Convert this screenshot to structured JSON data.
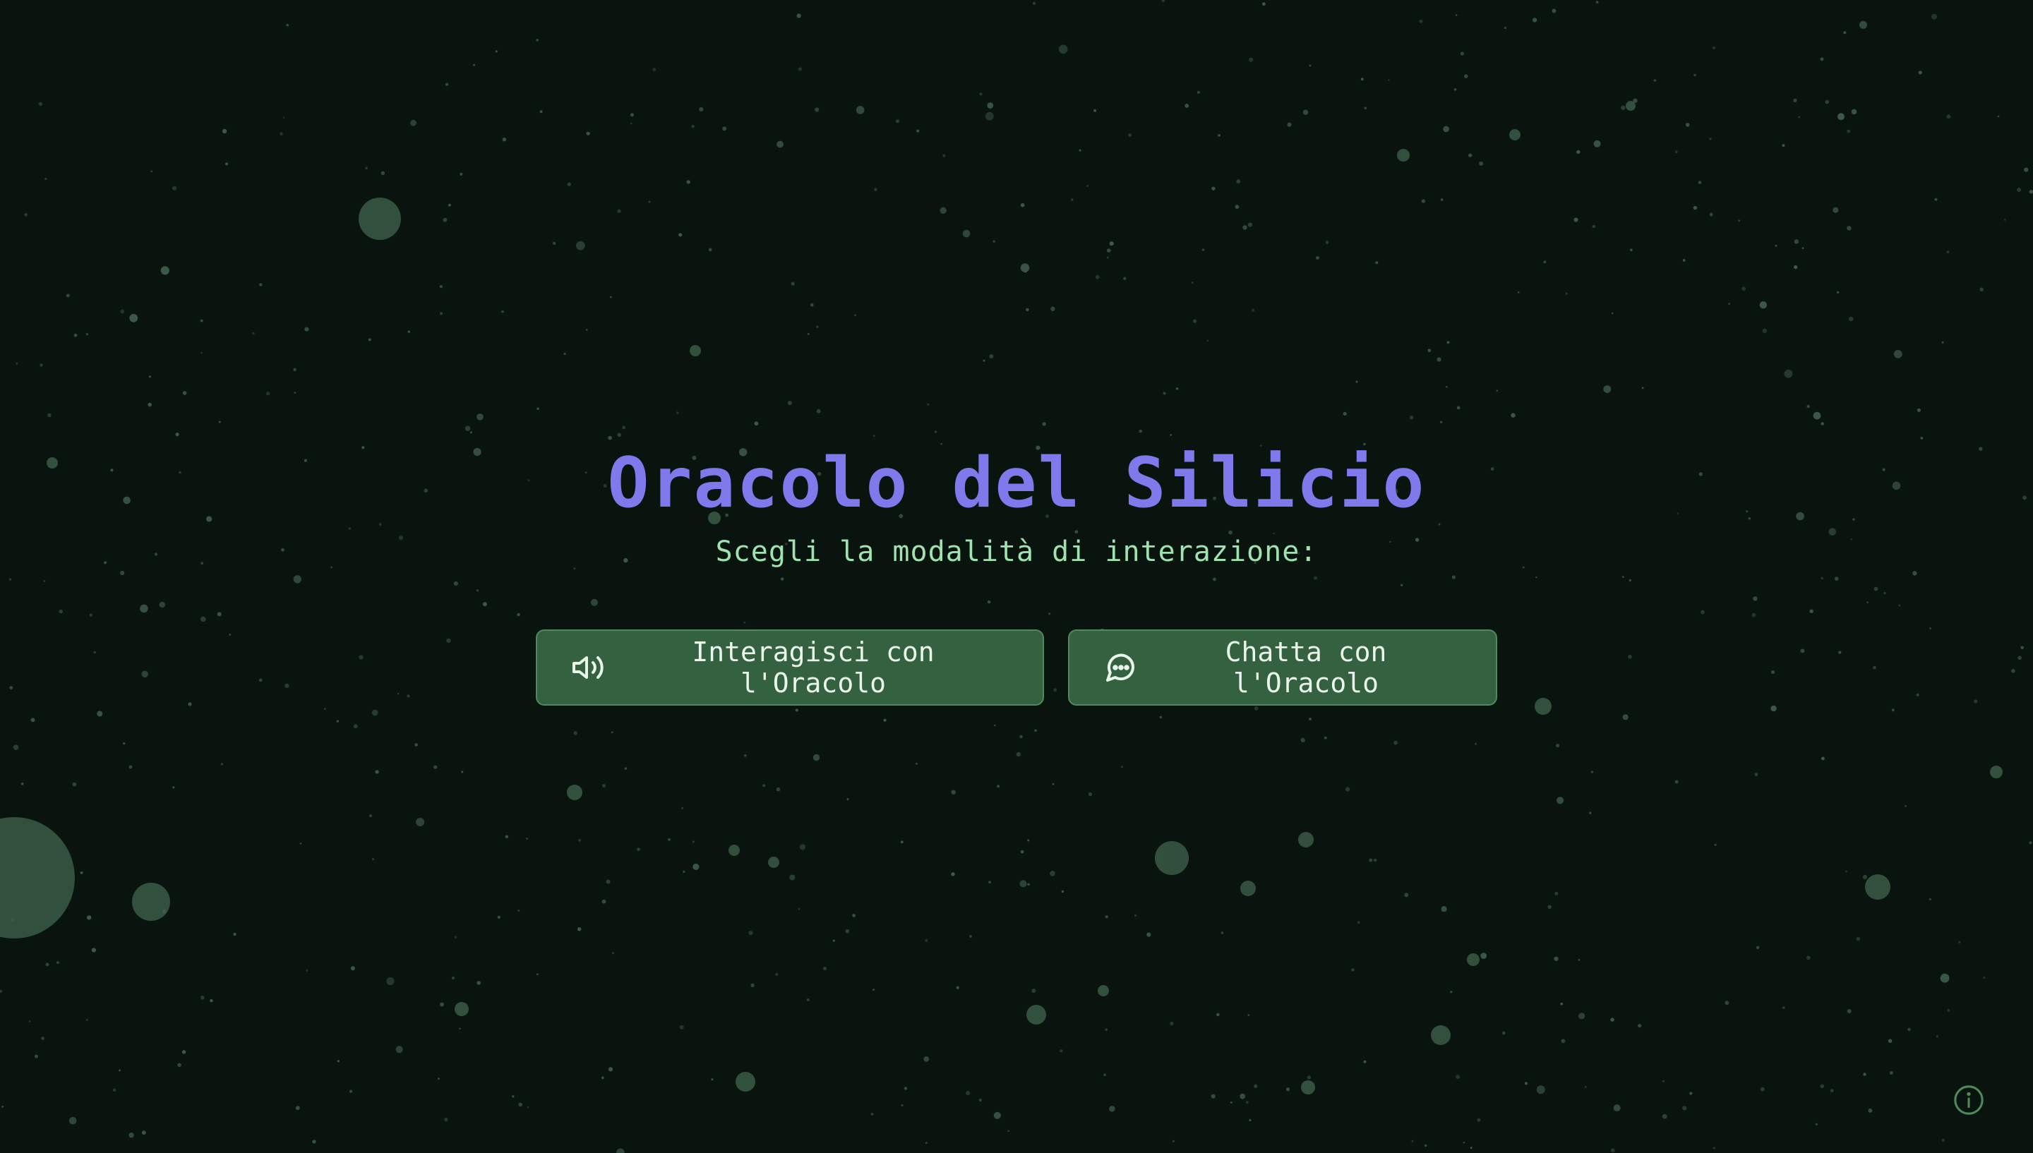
{
  "title": "Oracolo del Silicio",
  "subtitle": "Scegli la modalità di interazione:",
  "actions": [
    {
      "label": "Interagisci con l'Oracolo",
      "icon": "speaker-icon"
    },
    {
      "label": "Chatta con l'Oracolo",
      "icon": "chat-bubble-icon"
    }
  ],
  "info": {
    "icon": "info-icon"
  },
  "colors": {
    "background": "#0a140f",
    "title": "#8079ec",
    "subtitle": "#9fe3b0",
    "button_bg": "#346240",
    "button_border": "#4f8a5d",
    "button_text": "#eaf5ec",
    "particle": "#3f5e4b"
  }
}
